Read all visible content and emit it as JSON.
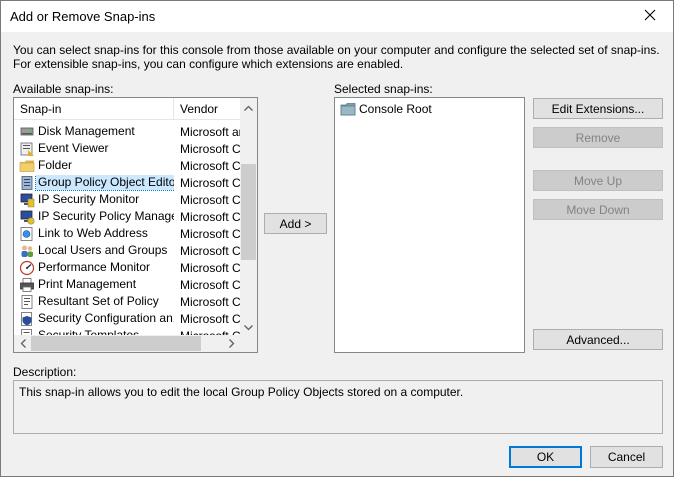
{
  "window": {
    "title": "Add or Remove Snap-ins",
    "close_icon": "close-icon"
  },
  "intro_text": "You can select snap-ins for this console from those available on your computer and configure the selected set of snap-ins. For extensible snap-ins, you can configure which extensions are enabled.",
  "available": {
    "label": "Available snap-ins:",
    "columns": {
      "snapin": "Snap-in",
      "vendor": "Vendor"
    },
    "rows": [
      {
        "name": "Disk Management",
        "vendor": "Microsoft and",
        "icon": "disk-management-icon"
      },
      {
        "name": "Event Viewer",
        "vendor": "Microsoft Co",
        "icon": "event-viewer-icon"
      },
      {
        "name": "Folder",
        "vendor": "Microsoft Co",
        "icon": "folder-icon"
      },
      {
        "name": "Group Policy Object Editor",
        "vendor": "Microsoft Co",
        "icon": "group-policy-icon",
        "selected": true
      },
      {
        "name": "IP Security Monitor",
        "vendor": "Microsoft Co",
        "icon": "ip-security-monitor-icon"
      },
      {
        "name": "IP Security Policy Manage...",
        "vendor": "Microsoft Co",
        "icon": "ip-security-policy-icon"
      },
      {
        "name": "Link to Web Address",
        "vendor": "Microsoft Co",
        "icon": "web-link-icon"
      },
      {
        "name": "Local Users and Groups",
        "vendor": "Microsoft Co",
        "icon": "users-groups-icon"
      },
      {
        "name": "Performance Monitor",
        "vendor": "Microsoft Co",
        "icon": "performance-monitor-icon"
      },
      {
        "name": "Print Management",
        "vendor": "Microsoft Co",
        "icon": "printer-icon"
      },
      {
        "name": "Resultant Set of Policy",
        "vendor": "Microsoft Co",
        "icon": "resultant-policy-icon"
      },
      {
        "name": "Security Configuration an...",
        "vendor": "Microsoft Co",
        "icon": "security-config-icon"
      },
      {
        "name": "Security Templates",
        "vendor": "Microsoft Co",
        "icon": "security-templates-icon"
      }
    ]
  },
  "add_button": "Add >",
  "selected": {
    "label": "Selected snap-ins:",
    "items": [
      {
        "name": "Console Root",
        "icon": "console-root-folder-icon"
      }
    ]
  },
  "side_buttons": {
    "edit_extensions": "Edit Extensions...",
    "remove": "Remove",
    "move_up": "Move Up",
    "move_down": "Move Down",
    "advanced": "Advanced..."
  },
  "description": {
    "label": "Description:",
    "text": "This snap-in allows you to edit the local Group Policy Objects stored on a computer."
  },
  "footer": {
    "ok": "OK",
    "cancel": "Cancel"
  },
  "colors": {
    "selection_bg": "#cce8ff",
    "focus": "#0078d7",
    "button_bg": "#e1e1e1",
    "disabled_button_bg": "#cccccc"
  }
}
